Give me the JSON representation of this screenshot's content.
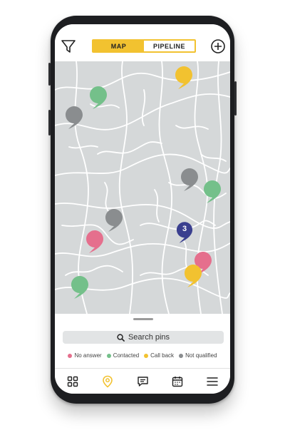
{
  "header": {
    "tabs": [
      {
        "label": "MAP",
        "active": true
      },
      {
        "label": "PIPELINE",
        "active": false
      }
    ],
    "icons": {
      "left": "filter-icon",
      "right": "add-circle-icon"
    }
  },
  "map": {
    "cluster_label": "3"
  },
  "sheet": {
    "search_label": "Search pins",
    "legend": [
      {
        "label": "No answer",
        "color": "#e56f8d"
      },
      {
        "label": "Contacted",
        "color": "#74c08a"
      },
      {
        "label": "Call back",
        "color": "#f2c230"
      },
      {
        "label": "Not qualified",
        "color": "#8a8d8f"
      }
    ]
  },
  "nav": {
    "items": [
      "grid-icon",
      "map-pin-icon",
      "chat-icon",
      "calendar-icon",
      "menu-icon"
    ],
    "active_index": 1
  },
  "colors": {
    "accent": "#f2c230",
    "cluster": "#3a3f8f",
    "map_bg": "#d5d8d9"
  }
}
